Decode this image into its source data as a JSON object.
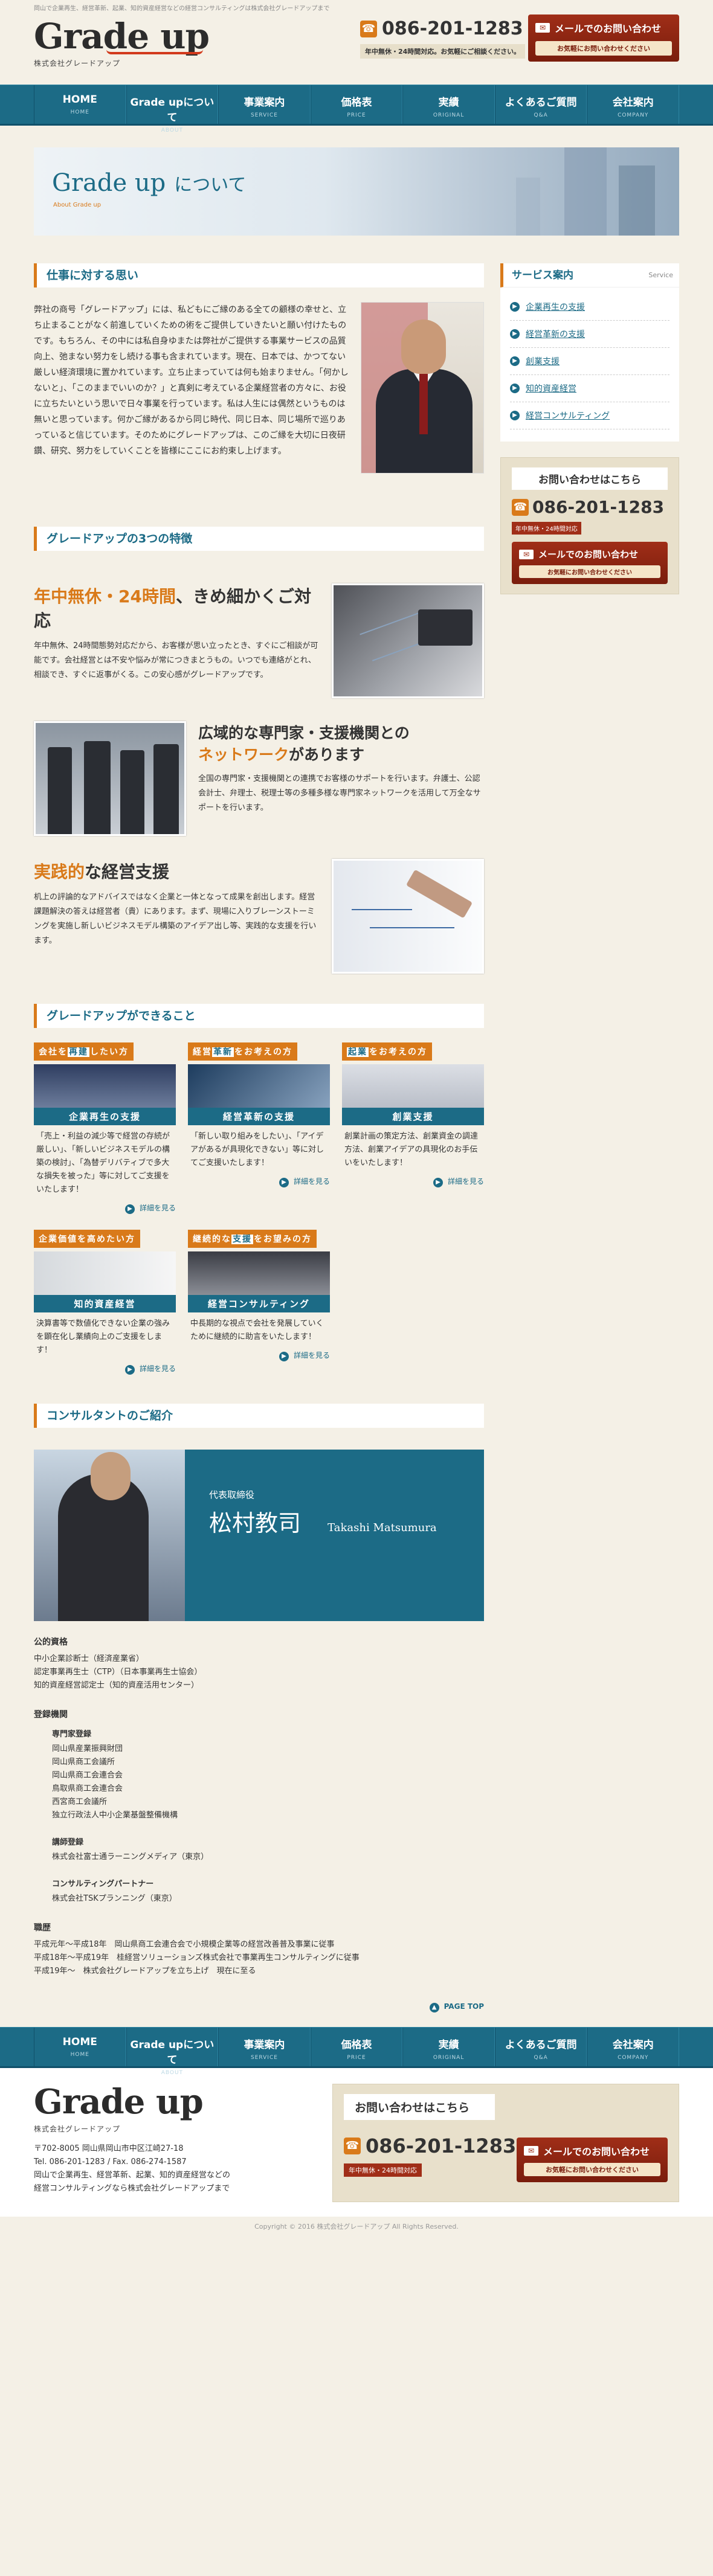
{
  "top_strip": "岡山で企業再生、経営革新、起業、知的資産経営などの経営コンサルティングは株式会社グレードアップまで",
  "logo": {
    "main": "Grade up",
    "sub": "株式会社グレードアップ"
  },
  "header": {
    "tel": "086-201-1283",
    "tel_note": "年中無休・24時間対応。お気軽にご相談ください。",
    "mail_label": "メールでのお問い合わせ",
    "mail_sub": "お気軽にお問い合わせください"
  },
  "nav": [
    {
      "jp": "HOME",
      "en": "HOME"
    },
    {
      "jp": "Grade upについて",
      "en": "ABOUT"
    },
    {
      "jp": "事業案内",
      "en": "SERVICE"
    },
    {
      "jp": "価格表",
      "en": "PRICE"
    },
    {
      "jp": "実績",
      "en": "ORIGINAL"
    },
    {
      "jp": "よくあるご質問",
      "en": "Q&A"
    },
    {
      "jp": "会社案内",
      "en": "COMPANY"
    }
  ],
  "hero": {
    "title": "Grade up",
    "title_suffix": "について",
    "sub": "About Grade up"
  },
  "sections": {
    "thought": "仕事に対する思い",
    "features": "グレードアップの3つの特徴",
    "cando": "グレードアップができること",
    "consultant": "コンサルタントのご紹介"
  },
  "intro_text": "弊社の商号「グレードアップ」には、私どもにご縁のある全ての顧様の幸せと、立ち止まることがなく前進していくための術をご提供していきたいと願い付けたものです。もちろん、その中には私自身ゆまたは弊社がご提供する事業サービスの品質向上、弛まない努力をし続ける事も含まれています。現在、日本では、かつてない厳しい経済環境に置かれています。立ち止まっていては何も始まりません。「何かしないと」、「このままでいいのか？」と真剣に考えている企業経営者の方々に、お役に立ちたいという思いで日々事業を行っています。私は人生には偶然というものは無いと思っています。何かご縁があるから同じ時代、同じ日本、同じ場所で巡りあっていると信じています。そのためにグレードアップは、このご縁を大切に日夜研鑽、研究、努力をしていくことを皆様にここにお約束し上げます。",
  "features": [
    {
      "accent": "年中無休・24時間",
      "title": "、きめ細かくご対応",
      "text": "年中無休、24時間態勢対応だから、お客様が思い立ったとき、すぐにご相談が可能です。会社経営とは不安や悩みが常につきまとうもの。いつでも連絡がとれ、相談でき、すぐに返事がくる。この安心感がグレードアップです。"
    },
    {
      "pre": "広域的な専門家・支援機関との",
      "accent": "ネットワーク",
      "title": "があります",
      "text": "全国の専門家・支援機関との連携でお客様のサポートを行います。弁護士、公認会計士、弁理士、税理士等の多種多様な専門家ネットワークを活用して万全なサポートを行います。"
    },
    {
      "accent": "実践的",
      "title": "な経営支援",
      "text": "机上の評論的なアドバイスではなく企業と一体となって成果を創出します。経営課題解決の答えは経営者（貴）にあります。まず、現場に入りブレーンストーミングを実施し新しいビジネスモデル構築のアイデア出し等、実践的な支援を行います。"
    }
  ],
  "cando": [
    {
      "tag_pre": "会社を",
      "tag_hl": "再建",
      "tag_post": "したい方",
      "caption": "企業再生の支援",
      "text": "「売上・利益の減少等で経営の存続が厳しい」、「新しいビジネスモデルの構築の検討」、「為替デリバティブで多大な損失を被った」等に対してご支援をいたします！",
      "more": "詳細を見る"
    },
    {
      "tag_pre": "経営",
      "tag_hl": "革新",
      "tag_post": "をお考えの方",
      "caption": "経営革新の支援",
      "text": "「新しい取り組みをしたい」、「アイデアがあるが具現化できない」等に対してご支援いたします！",
      "more": "詳細を見る"
    },
    {
      "tag_pre": "",
      "tag_hl": "起業",
      "tag_post": "をお考えの方",
      "caption": "創業支援",
      "text": "創業計画の策定方法、創業資金の調達方法、創業アイデアの具現化のお手伝いをいたします！",
      "more": "詳細を見る"
    },
    {
      "tag_pre": "企業価値",
      "tag_hl": "",
      "tag_post": "を高めたい方",
      "caption": "知的資産経営",
      "text": "決算書等で数値化できない企業の強みを顕在化し業績向上のご支援をします！",
      "more": "詳細を見る"
    },
    {
      "tag_pre": "継続的な",
      "tag_hl": "支援",
      "tag_post": "をお望みの方",
      "caption": "経営コンサルティング",
      "text": "中長期的な視点で会社を発展していくために継続的に助言をいたします！",
      "more": "詳細を見る"
    }
  ],
  "consultant": {
    "role": "代表取締役",
    "name": "松村教司",
    "name_en": "Takashi Matsumura",
    "qual_title": "公的資格",
    "quals": [
      "中小企業診断士（経済産業省）",
      "認定事業再生士（CTP）（日本事業再生士協会）",
      "知的資産経営認定士（知的資産活用センター）"
    ],
    "reg_title": "登録機関",
    "expert_title": "専門家登録",
    "experts": [
      "岡山県産業振興財団",
      "岡山県商工会議所",
      "岡山県商工会連合会",
      "鳥取県商工会連合会",
      "西宮商工会議所",
      "独立行政法人中小企業基盤整備機構"
    ],
    "lecturer_title": "講師登録",
    "lecturers": [
      "株式会社富士通ラーニングメディア（東京）"
    ],
    "partner_title": "コンサルティングパートナー",
    "partners": [
      "株式会社TSKプランニング（東京）"
    ],
    "career_title": "職歴",
    "career": [
      "平成元年〜平成18年　岡山県商工会連合会で小規模企業等の経営改善普及事業に従事",
      "平成18年〜平成19年　桂経営ソリューションズ株式会社で事業再生コンサルティングに従事",
      "平成19年〜　株式会社グレードアップを立ち上げ　現在に至る"
    ]
  },
  "pagetop": "PAGE TOP",
  "sidebar": {
    "title": "サービス案内",
    "title_en": "Service",
    "items": [
      "企業再生の支援",
      "経営革新の支援",
      "創業支援",
      "知的資産経営",
      "経営コンサルティング"
    ],
    "contact_title": "お問い合わせはこちら",
    "tel": "086-201-1283",
    "tel_note": "年中無休・24時間対応",
    "mail_label": "メールでのお問い合わせ",
    "mail_sub": "お気軽にお問い合わせください"
  },
  "footer": {
    "addr1": "〒702-8005 岡山県岡山市中区江崎27-18",
    "addr2": "Tel. 086-201-1283 / Fax. 086-274-1587",
    "addr3": "岡山で企業再生、経営革新、起業、知的資産経営などの",
    "addr4": "経営コンサルティングなら株式会社グレードアップまで",
    "contact_title": "お問い合わせはこちら",
    "tel": "086-201-1283",
    "tel_note": "年中無休・24時間対応",
    "mail_label": "メールでのお問い合わせ",
    "mail_sub": "お気軽にお問い合わせください",
    "copyright": "Copyright © 2016 株式会社グレードアップ All Rights Reserved."
  }
}
